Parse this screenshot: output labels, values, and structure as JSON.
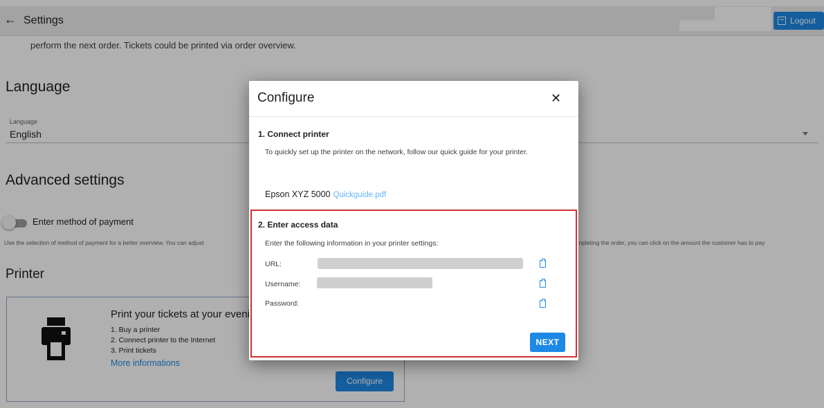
{
  "header": {
    "title": "Settings",
    "back_icon": "arrow-left-icon",
    "logout_label": "Logout",
    "logout_icon": "logout-icon"
  },
  "intro_text": "perform the next order. Tickets could be printed via order overview.",
  "language": {
    "heading": "Language",
    "field_label": "Language",
    "field_value": "English"
  },
  "advanced": {
    "heading": "Advanced settings",
    "toggle_label": "Enter method of payment",
    "help_left": "Use the selection of method of payment for a better overview. You can adjust",
    "help_right": "r completing the order, you can click on the amount the customer has to pay"
  },
  "printer": {
    "heading": "Printer",
    "card_title": "Print your tickets at your eveni",
    "steps": [
      "1. Buy a printer",
      "2. Connect printer to the Internet",
      "3. Print tickets"
    ],
    "more_link": "More informations",
    "configure_label": "Configure"
  },
  "modal": {
    "title": "Configure",
    "close_icon": "close-icon",
    "section1_title": "1. Connect printer",
    "section1_text": "To quickly set up the printer on the network, follow our quick guide for your printer.",
    "printer_model": "Epson XYZ 5000",
    "quickguide_link": "Quickguide.pdf",
    "section2_title": "2. Enter access data",
    "section2_text": "Enter the following information in your printer settings:",
    "fields": [
      {
        "label": "URL:"
      },
      {
        "label": "Username:"
      },
      {
        "label": "Password:"
      }
    ],
    "copy_icon": "clipboard-icon",
    "next_label": "NEXT"
  },
  "colors": {
    "accent": "#1e88e5",
    "highlight_border": "#d32f2f",
    "link": "#64b5f6"
  }
}
